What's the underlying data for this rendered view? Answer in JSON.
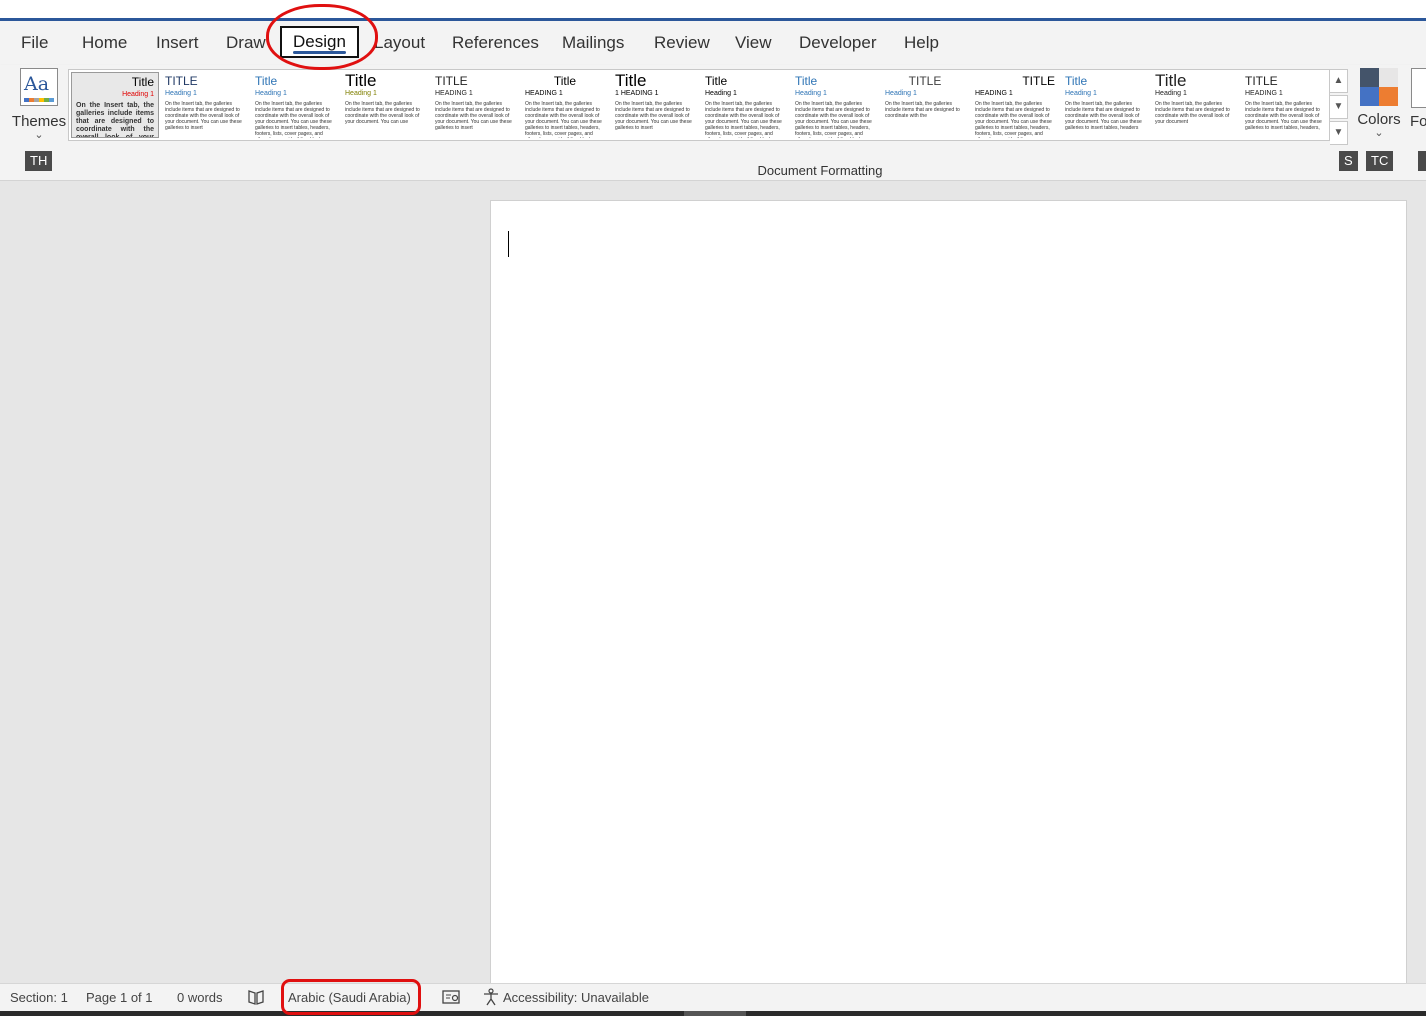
{
  "tabs": [
    {
      "label": "File"
    },
    {
      "label": "Home"
    },
    {
      "label": "Insert"
    },
    {
      "label": "Draw"
    },
    {
      "label": "Design",
      "active": true
    },
    {
      "label": "Layout"
    },
    {
      "label": "References"
    },
    {
      "label": "Mailings"
    },
    {
      "label": "Review"
    },
    {
      "label": "View"
    },
    {
      "label": "Developer"
    },
    {
      "label": "Help"
    }
  ],
  "ribbon": {
    "themes_label": "Themes",
    "themes_keytip": "TH",
    "colors_label": "Colors",
    "colors_keytip": "TC",
    "fonts_label": "Fonts",
    "styles_keytip": "S",
    "group_label": "Document Formatting",
    "theme_colors": [
      "#44546a",
      "#e7e6e6",
      "#4472c4",
      "#ed7d31"
    ],
    "style_sets": [
      {
        "title": "Title",
        "heading": "Heading 1",
        "body": "On the Insert tab, the galleries include items that are designed to coordinate with the overall look of your document. You can",
        "title_color": "#000000",
        "heading_color": "#e00000",
        "title_align": "right",
        "selected": true
      },
      {
        "title": "TITLE",
        "heading": "Heading 1",
        "body": "On the Insert tab, the galleries include items that are designed to coordinate with the overall look of your document. You can use these galleries to insert",
        "title_color": "#1f3864",
        "heading_color": "#2e74b5",
        "title_align": "left"
      },
      {
        "title": "Title",
        "heading": "Heading 1",
        "body": "On the Insert tab, the galleries include items that are designed to coordinate with the overall look of your document. You can use these galleries to insert tables, headers, footers, lists, cover pages, and other document building blocks.",
        "title_color": "#2e74b5",
        "heading_color": "#2e74b5",
        "title_align": "left"
      },
      {
        "title": "Title",
        "heading": "Heading 1",
        "body": "On the Insert tab, the galleries include items that are designed to coordinate with the overall look of your document. You can use",
        "title_color": "#000000",
        "heading_color": "#7f7f00",
        "title_align": "left"
      },
      {
        "title": "TITLE",
        "heading": "HEADING 1",
        "body": "On the Insert tab, the galleries include items that are designed to coordinate with the overall look of your document. You can use these galleries to insert",
        "title_color": "#222222",
        "heading_color": "#222222",
        "title_align": "left"
      },
      {
        "title": "Title",
        "heading": "HEADING 1",
        "body": "On the Insert tab, the galleries include items that are designed to coordinate with the overall look of your document. You can use these galleries to insert tables, headers, footers, lists, cover pages, and other document building blocks.",
        "title_color": "#000000",
        "heading_color": "#000000",
        "title_align": "center"
      },
      {
        "title": "Title",
        "heading": "1   HEADING 1",
        "body": "On the Insert tab, the galleries include items that are designed to coordinate with the overall look of your document. You can use these galleries to insert",
        "title_color": "#000000",
        "heading_color": "#000000",
        "title_align": "left"
      },
      {
        "title": "Title",
        "heading": "Heading 1",
        "body": "On the Insert tab, the galleries include items that are designed to coordinate with the overall look of your document. You can use these galleries to insert tables, headers, footers, lists, cover pages, and other document building blocks.",
        "title_color": "#000000",
        "heading_color": "#000000",
        "title_align": "left"
      },
      {
        "title": "Title",
        "heading": "Heading 1",
        "body": "On the Insert tab, the galleries include items that are designed to coordinate with the overall look of your document. You can use these galleries to insert tables, headers, footers, lists, cover pages, and other document building blocks.",
        "title_color": "#2e74b5",
        "heading_color": "#2e74b5",
        "title_align": "left"
      },
      {
        "title": "TITLE",
        "heading": "Heading 1",
        "body": "On the Insert tab, the galleries include items that are designed to coordinate with the",
        "title_color": "#404040",
        "heading_color": "#2e74b5",
        "title_align": "center"
      },
      {
        "title": "TITLE",
        "heading": "HEADING 1",
        "body": "On the Insert tab, the galleries include items that are designed to coordinate with the overall look of your document. You can use these galleries to insert tables, headers, footers, lists, cover pages, and other document building",
        "title_color": "#000000",
        "heading_color": "#000000",
        "title_align": "right"
      },
      {
        "title": "Title",
        "heading": "Heading 1",
        "body": "On the Insert tab, the galleries include items that are designed to coordinate with the overall look of your document. You can use these galleries to insert tables, headers",
        "title_color": "#2e74b5",
        "heading_color": "#2e74b5",
        "title_align": "left"
      },
      {
        "title": "Title",
        "heading": "Heading 1",
        "body": "On the Insert tab, the galleries include items that are designed to coordinate with the overall look of your document",
        "title_color": "#222222",
        "heading_color": "#222222",
        "title_align": "left"
      },
      {
        "title": "TITLE",
        "heading": "HEADING 1",
        "body": "On the Insert tab, the galleries include items that are designed to coordinate with the overall look of your document. You can use these galleries to insert tables, headers,",
        "title_color": "#222222",
        "heading_color": "#222222",
        "title_align": "left"
      }
    ]
  },
  "status": {
    "section": "Section: 1",
    "page": "Page 1 of 1",
    "words": "0 words",
    "language": "Arabic (Saudi Arabia)",
    "accessibility": "Accessibility: Unavailable"
  }
}
